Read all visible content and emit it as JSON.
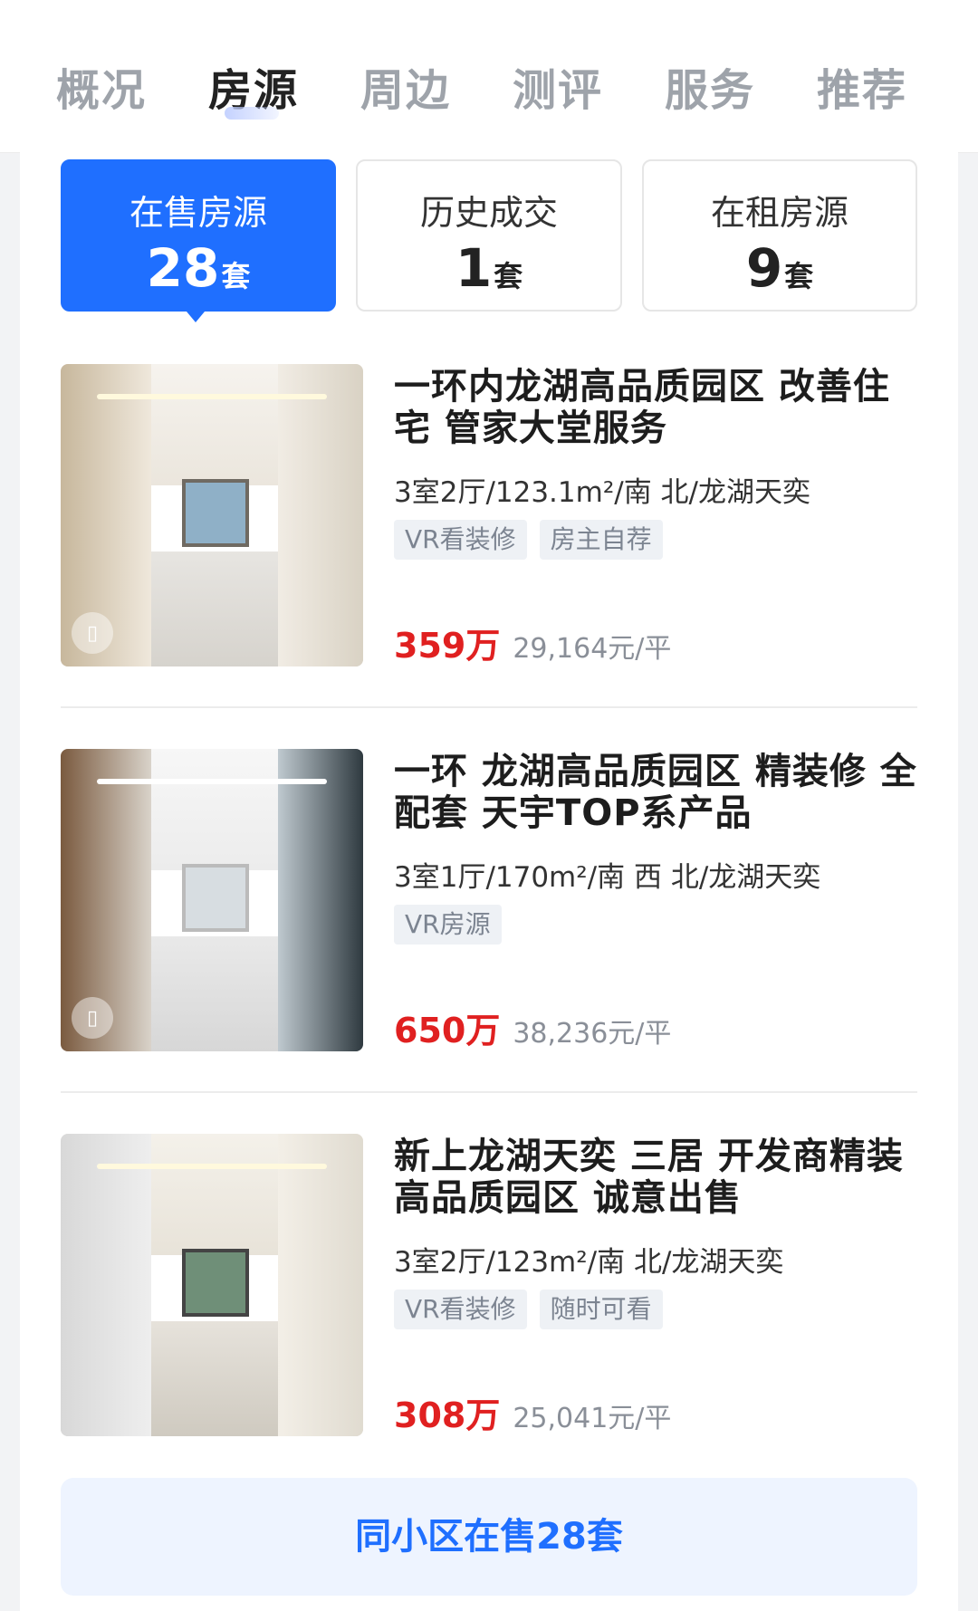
{
  "tabs": [
    "概况",
    "房源",
    "周边",
    "测评",
    "服务",
    "推荐"
  ],
  "active_tab": "房源",
  "segments": [
    {
      "label": "在售房源",
      "count": "28",
      "unit": "套"
    },
    {
      "label": "历史成交",
      "count": "1",
      "unit": "套"
    },
    {
      "label": "在租房源",
      "count": "9",
      "unit": "套"
    }
  ],
  "listings": [
    {
      "title": "一环内龙湖高品质园区 改善住宅 管家大堂服务",
      "meta": "3室2厅/123.1m²/南 北/龙湖天奕",
      "tags": [
        "VR看装修",
        "房主自荐"
      ],
      "price": "359万",
      "unit_price": "29,164元/平"
    },
    {
      "title": "一环 龙湖高品质园区 精装修 全配套 天宇TOP系产品",
      "meta": "3室1厅/170m²/南 西 北/龙湖天奕",
      "tags": [
        "VR房源"
      ],
      "price": "650万",
      "unit_price": "38,236元/平"
    },
    {
      "title": "新上龙湖天奕 三居 开发商精装 高品质园区 诚意出售",
      "meta": "3室2厅/123m²/南 北/龙湖天奕",
      "tags": [
        "VR看装修",
        "随时可看"
      ],
      "price": "308万",
      "unit_price": "25,041元/平"
    }
  ],
  "more_button": "同小区在售28套",
  "colors": {
    "accent": "#1f6fff",
    "price": "#e02020"
  }
}
